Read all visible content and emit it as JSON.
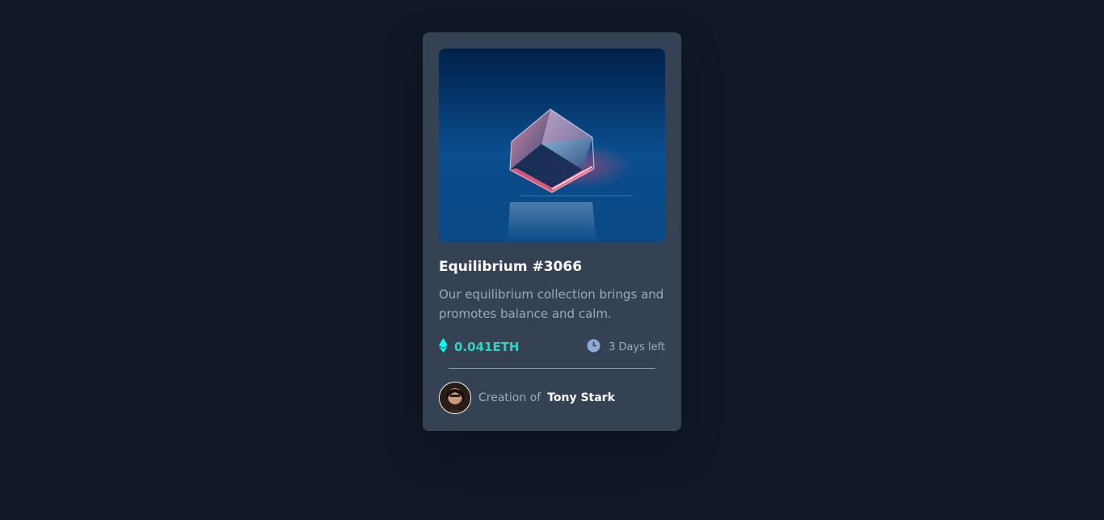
{
  "card": {
    "title": "Equilibrium #3066",
    "description": "Our equilibrium collection brings and promotes balance and calm.",
    "price": "0.041ETH",
    "time_left": "3 Days left",
    "creation_label": "Creation of",
    "creator_name": "Tony Stark"
  },
  "icons": {
    "price": "ethereum-icon",
    "time": "clock-icon"
  },
  "colors": {
    "background": "#101728",
    "card": "#354253",
    "accent_cyan": "#2fd3c4",
    "muted_text": "#9aa9bd",
    "white": "#ffffff"
  }
}
